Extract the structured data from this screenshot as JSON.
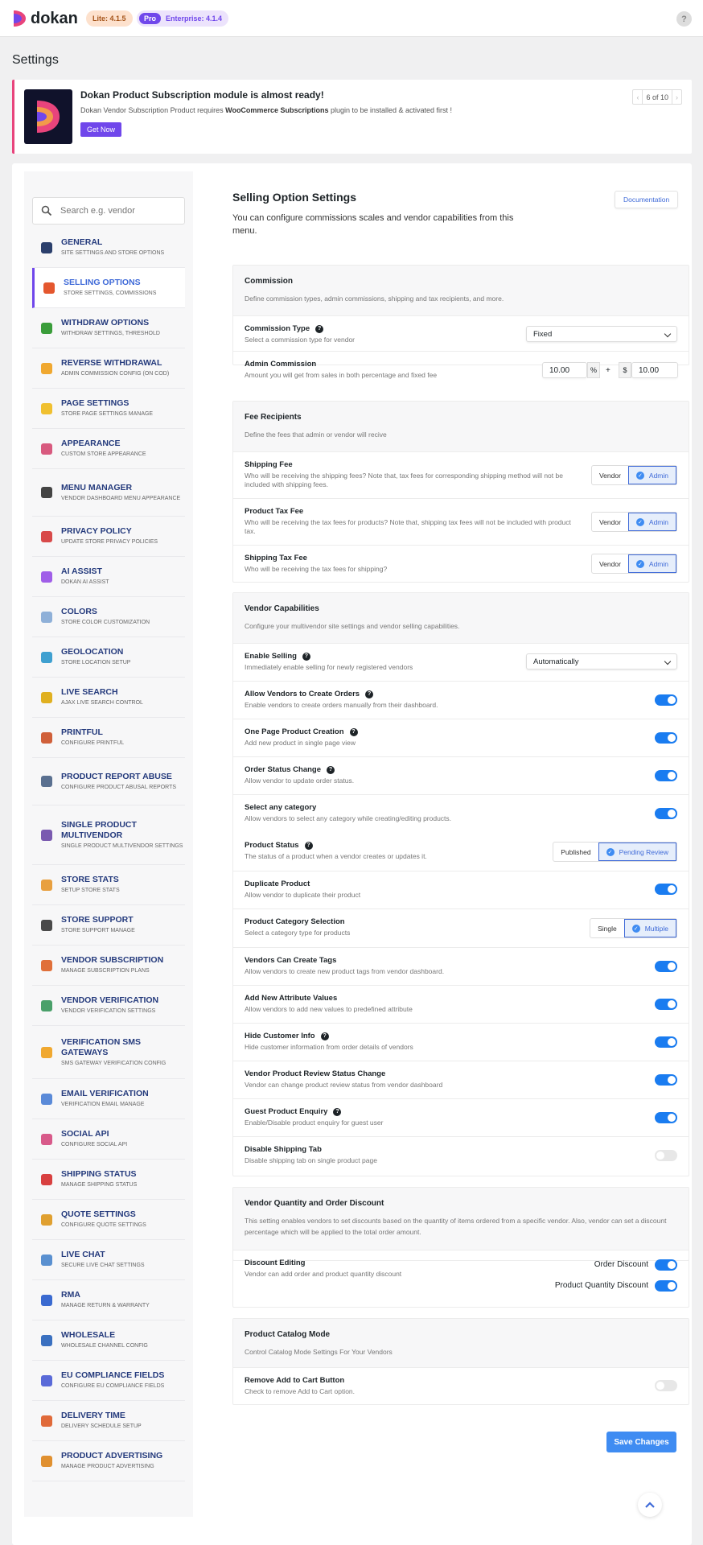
{
  "header": {
    "logo_text": "dokan",
    "lite_badge": "Lite: 4.1.5",
    "pro_tag": "Pro",
    "enterprise_badge": "Enterprise: 4.1.4",
    "help": "?"
  },
  "page_title": "Settings",
  "notice": {
    "title": "Dokan Product Subscription module is almost ready!",
    "desc_pre": "Dokan Vendor Subscription Product requires ",
    "desc_bold": "WooCommerce Subscriptions",
    "desc_post": " plugin to be installed & activated first !",
    "button": "Get Now",
    "pager": "6 of 10"
  },
  "search": {
    "placeholder": "Search e.g. vendor"
  },
  "sidebar": [
    {
      "title": "General",
      "sub": "Site Settings and Store Options",
      "color": "#2b3f6c"
    },
    {
      "title": "Selling Options",
      "sub": "Store Settings, Commissions",
      "color": "#e4572e"
    },
    {
      "title": "Withdraw Options",
      "sub": "Withdraw Settings, Threshold",
      "color": "#3a9d3a"
    },
    {
      "title": "Reverse Withdrawal",
      "sub": "Admin commission config (on COD)",
      "color": "#f0a830"
    },
    {
      "title": "Page Settings",
      "sub": "Store Page Settings Manage",
      "color": "#f0c030"
    },
    {
      "title": "Appearance",
      "sub": "Custom Store Appearance",
      "color": "#d85a7f"
    },
    {
      "title": "Menu Manager",
      "sub": "Vendor Dashboard Menu Appearance",
      "color": "#444"
    },
    {
      "title": "Privacy Policy",
      "sub": "Update Store Privacy Policies",
      "color": "#d84a4a"
    },
    {
      "title": "AI Assist",
      "sub": "Dokan AI Assist",
      "color": "#a05ee8"
    },
    {
      "title": "Colors",
      "sub": "Store Color Customization",
      "color": "#8fb0d8"
    },
    {
      "title": "Geolocation",
      "sub": "Store Location Setup",
      "color": "#3fa0d0"
    },
    {
      "title": "Live Search",
      "sub": "Ajax Live Search Control",
      "color": "#e0b020"
    },
    {
      "title": "Printful",
      "sub": "Configure Printful",
      "color": "#d0603a"
    },
    {
      "title": "Product Report Abuse",
      "sub": "Configure Product Abusal Reports",
      "color": "#5a7090"
    },
    {
      "title": "Single Product MultiVendor",
      "sub": "Single Product Multivendor Settings",
      "color": "#7a5ab0"
    },
    {
      "title": "Store Stats",
      "sub": "Setup Store Stats",
      "color": "#e8a040"
    },
    {
      "title": "Store Support",
      "sub": "Store Support Manage",
      "color": "#4a4a4a"
    },
    {
      "title": "Vendor Subscription",
      "sub": "Manage Subscription Plans",
      "color": "#e0703a"
    },
    {
      "title": "Vendor Verification",
      "sub": "Vendor Verification Settings",
      "color": "#4aa06a"
    },
    {
      "title": "Verification SMS Gateways",
      "sub": "SMS Gateway Verification Config",
      "color": "#f0a830"
    },
    {
      "title": "Email Verification",
      "sub": "Verification Email Manage",
      "color": "#5a8ad8"
    },
    {
      "title": "Social API",
      "sub": "Configure Social API",
      "color": "#d85a8a"
    },
    {
      "title": "Shipping Status",
      "sub": "Manage Shipping Status",
      "color": "#d84040"
    },
    {
      "title": "Quote Settings",
      "sub": "Configure Quote Settings",
      "color": "#e0a030"
    },
    {
      "title": "Live Chat",
      "sub": "Secure Live Chat Settings",
      "color": "#5a90d0"
    },
    {
      "title": "RMA",
      "sub": "Manage Return & Warranty",
      "color": "#3a6ad0"
    },
    {
      "title": "Wholesale",
      "sub": "Wholesale Channel Config",
      "color": "#3a70c0"
    },
    {
      "title": "EU Compliance Fields",
      "sub": "Configure EU Compliance Fields",
      "color": "#5a6ad8"
    },
    {
      "title": "Delivery Time",
      "sub": "Delivery Schedule Setup",
      "color": "#e06a3a"
    },
    {
      "title": "Product Advertising",
      "sub": "Manage Product Advertising",
      "color": "#e09030"
    }
  ],
  "main": {
    "title": "Selling Option Settings",
    "desc": "You can configure commissions scales and vendor capabilities from this menu.",
    "doc_button": "Documentation",
    "commission": {
      "title": "Commission",
      "desc": "Define commission types, admin commissions, shipping and tax recipients, and more.",
      "type_label": "Commission Type",
      "type_desc": "Select a commission type for vendor",
      "type_value": "Fixed",
      "admin_label": "Admin Commission",
      "admin_desc": "Amount you will get from sales in both percentage and fixed fee",
      "percent_value": "10.00",
      "percent_unit": "%",
      "plus": "+",
      "fixed_unit": "$",
      "fixed_value": "10.00"
    },
    "fees": {
      "title": "Fee Recipients",
      "desc": "Define the fees that admin or vendor will recive",
      "vendor": "Vendor",
      "admin": "Admin",
      "shipping_label": "Shipping Fee",
      "shipping_desc": "Who will be receiving the shipping fees? Note that, tax fees for corresponding shipping method will not be included with shipping fees.",
      "tax_label": "Product Tax Fee",
      "tax_desc": "Who will be receiving the tax fees for products? Note that, shipping tax fees will not be included with product tax.",
      "shiptax_label": "Shipping Tax Fee",
      "shiptax_desc": "Who will be receiving the tax fees for shipping?"
    },
    "capabilities": {
      "title": "Vendor Capabilities",
      "desc": "Configure your multivendor site settings and vendor selling capabilities.",
      "enable_selling": {
        "label": "Enable Selling",
        "desc": "Immediately enable selling for newly registered vendors",
        "value": "Automatically"
      },
      "rows": [
        {
          "label": "Allow Vendors to Create Orders",
          "desc": "Enable vendors to create orders manually from their dashboard.",
          "q": true,
          "on": true
        },
        {
          "label": "One Page Product Creation",
          "desc": "Add new product in single page view",
          "q": true,
          "on": true
        },
        {
          "label": "Order Status Change",
          "desc": "Allow vendor to update order status.",
          "q": true,
          "on": true
        },
        {
          "label": "Select any category",
          "desc": "Allow vendors to select any category while creating/editing products.",
          "q": false,
          "on": true
        }
      ],
      "product_status": {
        "label": "Product Status",
        "desc": "The status of a product when a vendor creates or updates it.",
        "opt1": "Published",
        "opt2": "Pending Review"
      },
      "duplicate": {
        "label": "Duplicate Product",
        "desc": "Allow vendor to duplicate their product",
        "on": true
      },
      "category_selection": {
        "label": "Product Category Selection",
        "desc": "Select a category type for products",
        "opt1": "Single",
        "opt2": "Multiple"
      },
      "rows2": [
        {
          "label": "Vendors Can Create Tags",
          "desc": "Allow vendors to create new product tags from vendor dashboard.",
          "q": false,
          "on": true
        },
        {
          "label": "Add New Attribute Values",
          "desc": "Allow vendors to add new values to predefined attribute",
          "q": false,
          "on": true
        },
        {
          "label": "Hide Customer Info",
          "desc": "Hide customer information from order details of vendors",
          "q": true,
          "on": true
        },
        {
          "label": "Vendor Product Review Status Change",
          "desc": "Vendor can change product review status from vendor dashboard",
          "q": false,
          "on": true
        },
        {
          "label": "Guest Product Enquiry",
          "desc": "Enable/Disable product enquiry for guest user",
          "q": true,
          "on": true
        },
        {
          "label": "Disable Shipping Tab",
          "desc": "Disable shipping tab on single product page",
          "q": false,
          "on": false
        }
      ]
    },
    "discount": {
      "title": "Vendor Quantity and Order Discount",
      "desc": "This setting enables vendors to set discounts based on the quantity of items ordered from a specific vendor. Also, vendor can set a discount percentage which will be applied to the total order amount.",
      "label": "Discount Editing",
      "row_desc": "Vendor can add order and product quantity discount",
      "order_discount": "Order Discount",
      "qty_discount": "Product Quantity Discount"
    },
    "catalog": {
      "title": "Product Catalog Mode",
      "desc": "Control Catalog Mode Settings For Your Vendors",
      "label": "Remove Add to Cart Button",
      "row_desc": "Check to remove Add to Cart option."
    },
    "save_button": "Save Changes"
  }
}
